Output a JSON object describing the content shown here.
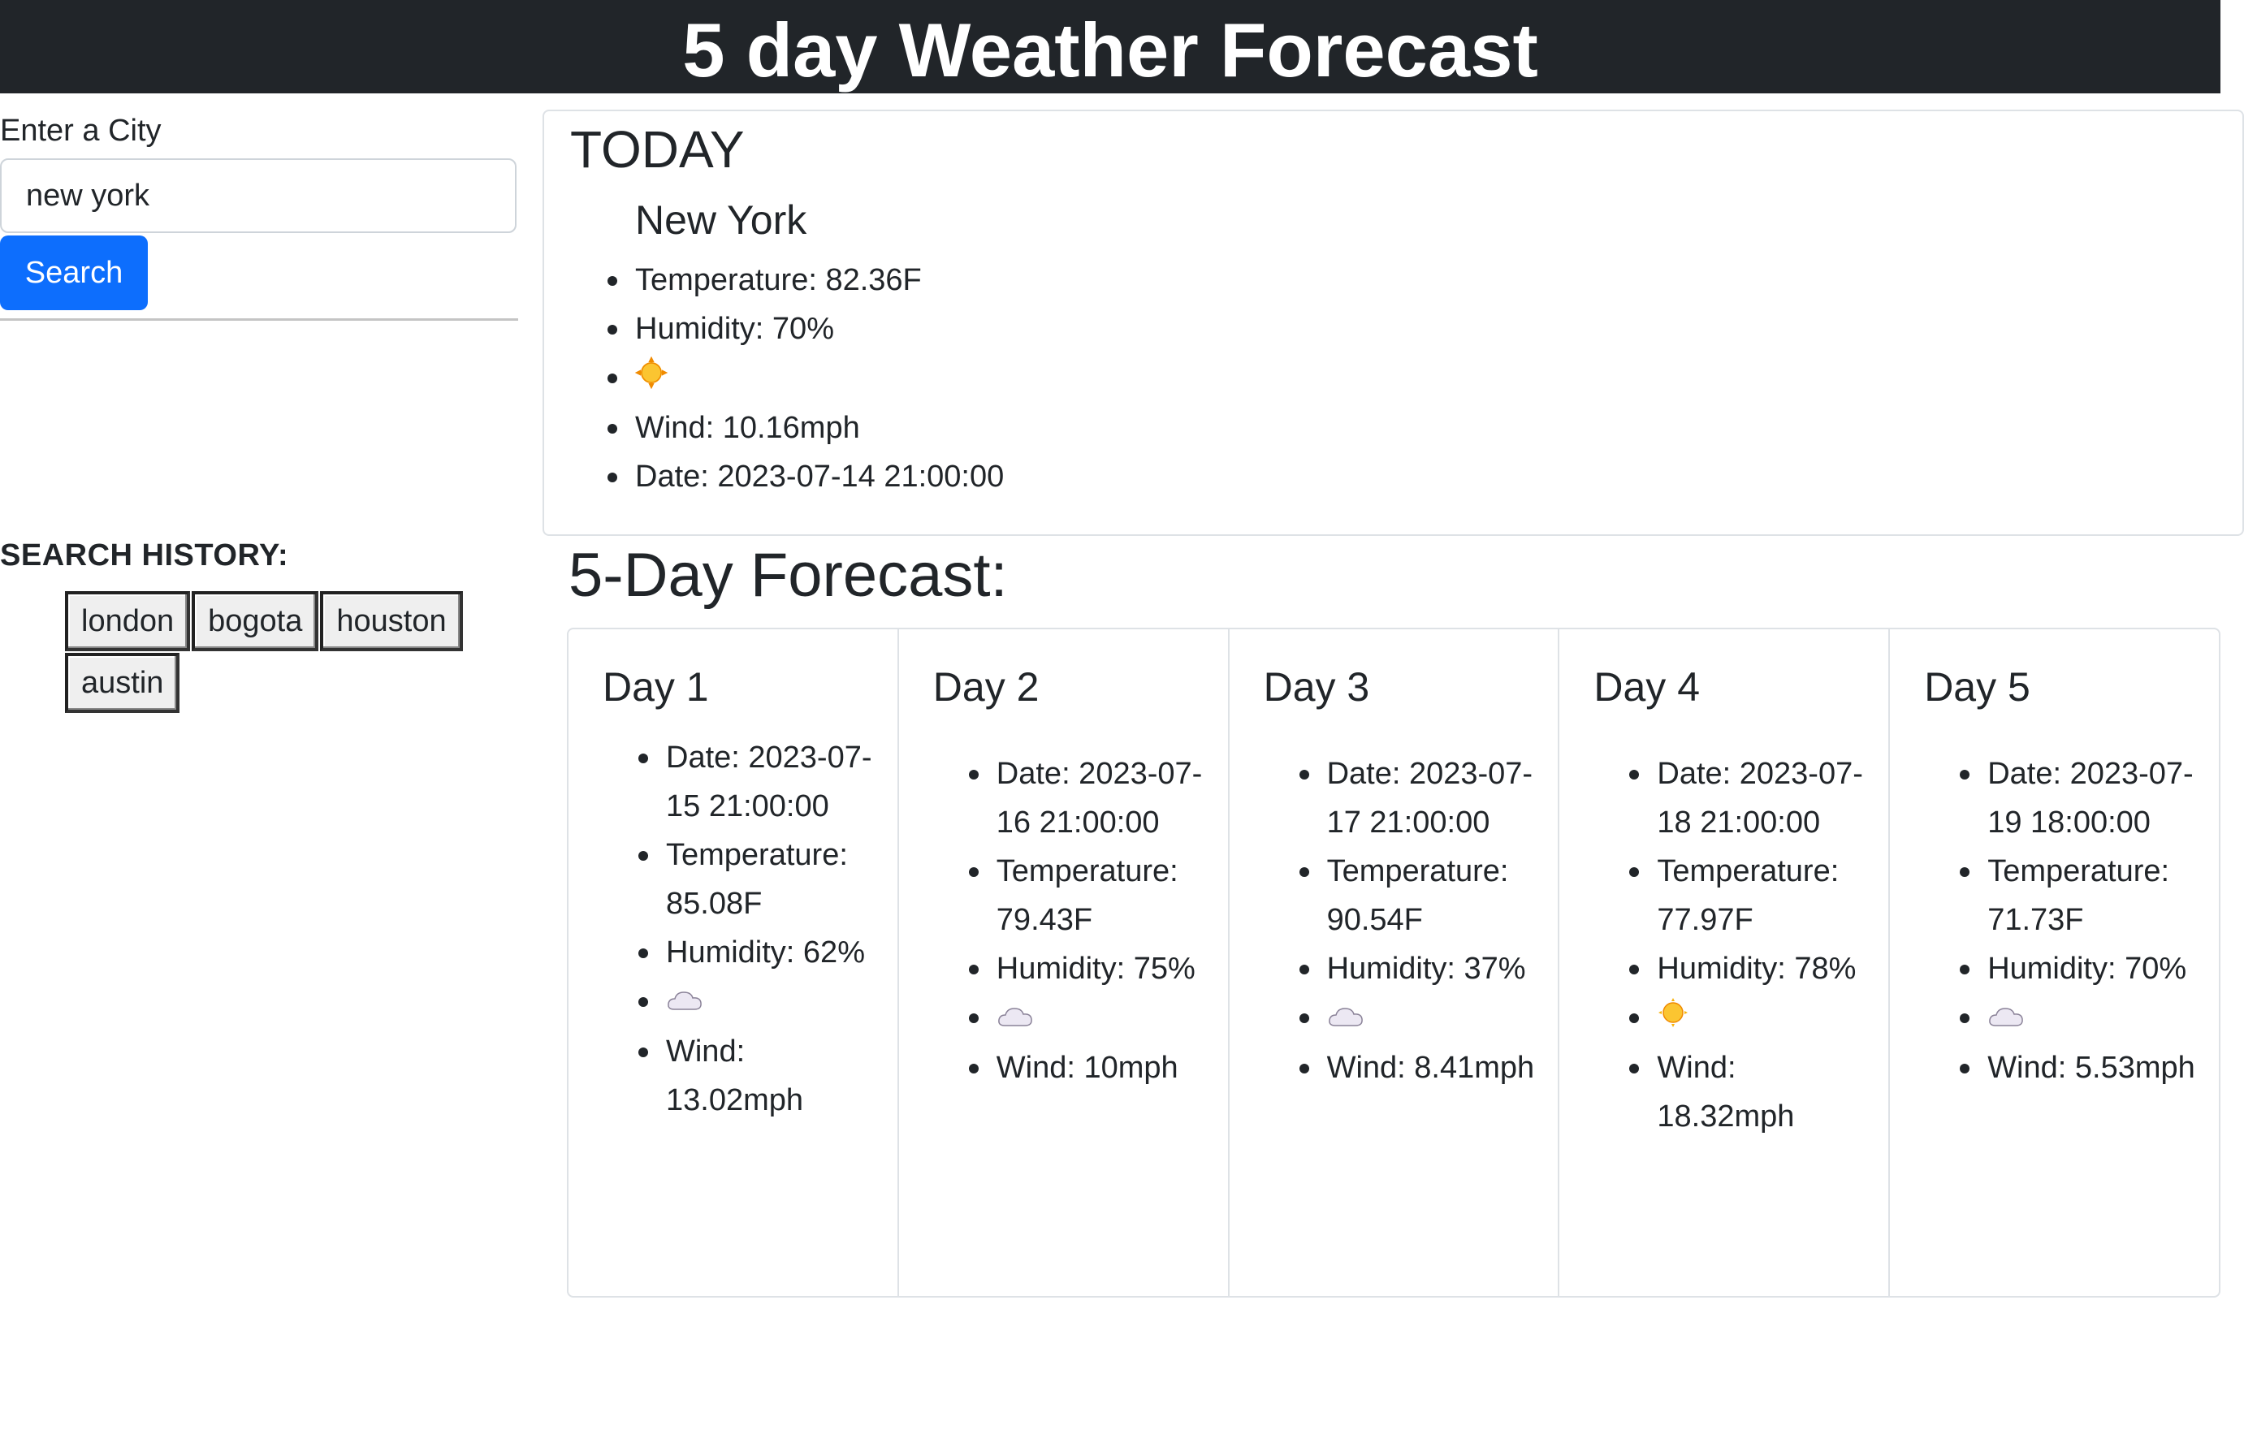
{
  "header": {
    "title": "5 day Weather Forecast"
  },
  "sidebar": {
    "city_label": "Enter a City",
    "city_value": "new york",
    "search_label": "Search",
    "history_title": "SEARCH HISTORY:",
    "history": [
      "london",
      "bogota",
      "houston",
      "austin"
    ]
  },
  "today": {
    "heading": "TODAY",
    "city": "New York",
    "temperature": "Temperature: 82.36F",
    "humidity": "Humidity: 70%",
    "icon": "sun-icon",
    "wind": "Wind: 10.16mph",
    "date": "Date: 2023-07-14 21:00:00"
  },
  "forecast": {
    "heading": "5-Day Forecast:",
    "days": [
      {
        "label": "Day 1",
        "date": "Date: 2023-07-15 21:00:00",
        "temperature": "Temperature: 85.08F",
        "humidity": "Humidity: 62%",
        "icon": "cloud-icon",
        "wind": "Wind: 13.02mph"
      },
      {
        "label": "Day 2",
        "date": "Date: 2023-07-16 21:00:00",
        "temperature": "Temperature: 79.43F",
        "humidity": "Humidity: 75%",
        "icon": "cloud-icon",
        "wind": "Wind: 10mph"
      },
      {
        "label": "Day 3",
        "date": "Date: 2023-07-17 21:00:00",
        "temperature": "Temperature: 90.54F",
        "humidity": "Humidity: 37%",
        "icon": "cloud-icon",
        "wind": "Wind: 8.41mph"
      },
      {
        "label": "Day 4",
        "date": "Date: 2023-07-18 21:00:00",
        "temperature": "Temperature: 77.97F",
        "humidity": "Humidity: 78%",
        "icon": "sun-icon",
        "wind": "Wind: 18.32mph"
      },
      {
        "label": "Day 5",
        "date": "Date: 2023-07-19 18:00:00",
        "temperature": "Temperature: 71.73F",
        "humidity": "Humidity: 70%",
        "icon": "cloud-icon",
        "wind": "Wind: 5.53mph"
      }
    ]
  },
  "colors": {
    "header_bg": "#212529",
    "primary": "#0d6efd",
    "sun": "#f9b208",
    "cloud": "#ece8f3"
  }
}
